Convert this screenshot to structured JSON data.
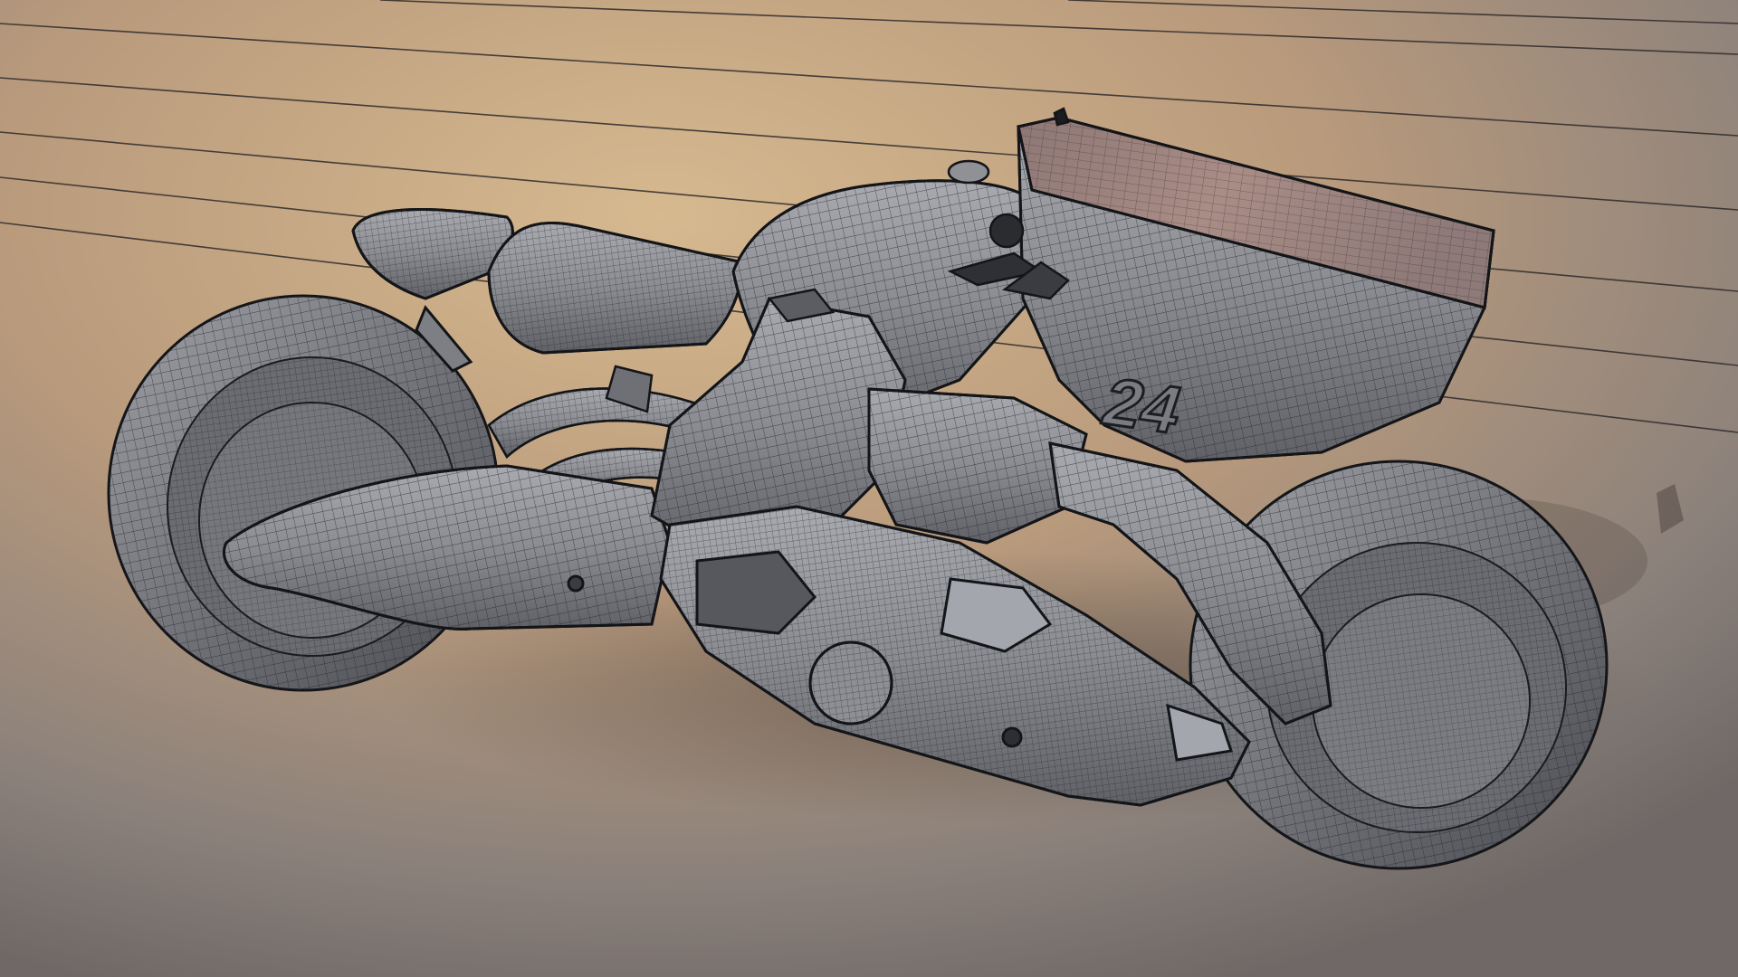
{
  "scene": {
    "subject": "motorcycle-wireframe-render",
    "plate_number": "24",
    "colors": {
      "bg_warm": "#d3b48d",
      "bg_cool": "#7c7672",
      "bg_dark": "#6f6866",
      "body_fill": "#8b8d93",
      "body_light": "#a3a6ac",
      "body_dark": "#5b5d63",
      "tank_top": "#a08783",
      "wire_line": "#2a2c31",
      "outline": "#141518"
    }
  }
}
